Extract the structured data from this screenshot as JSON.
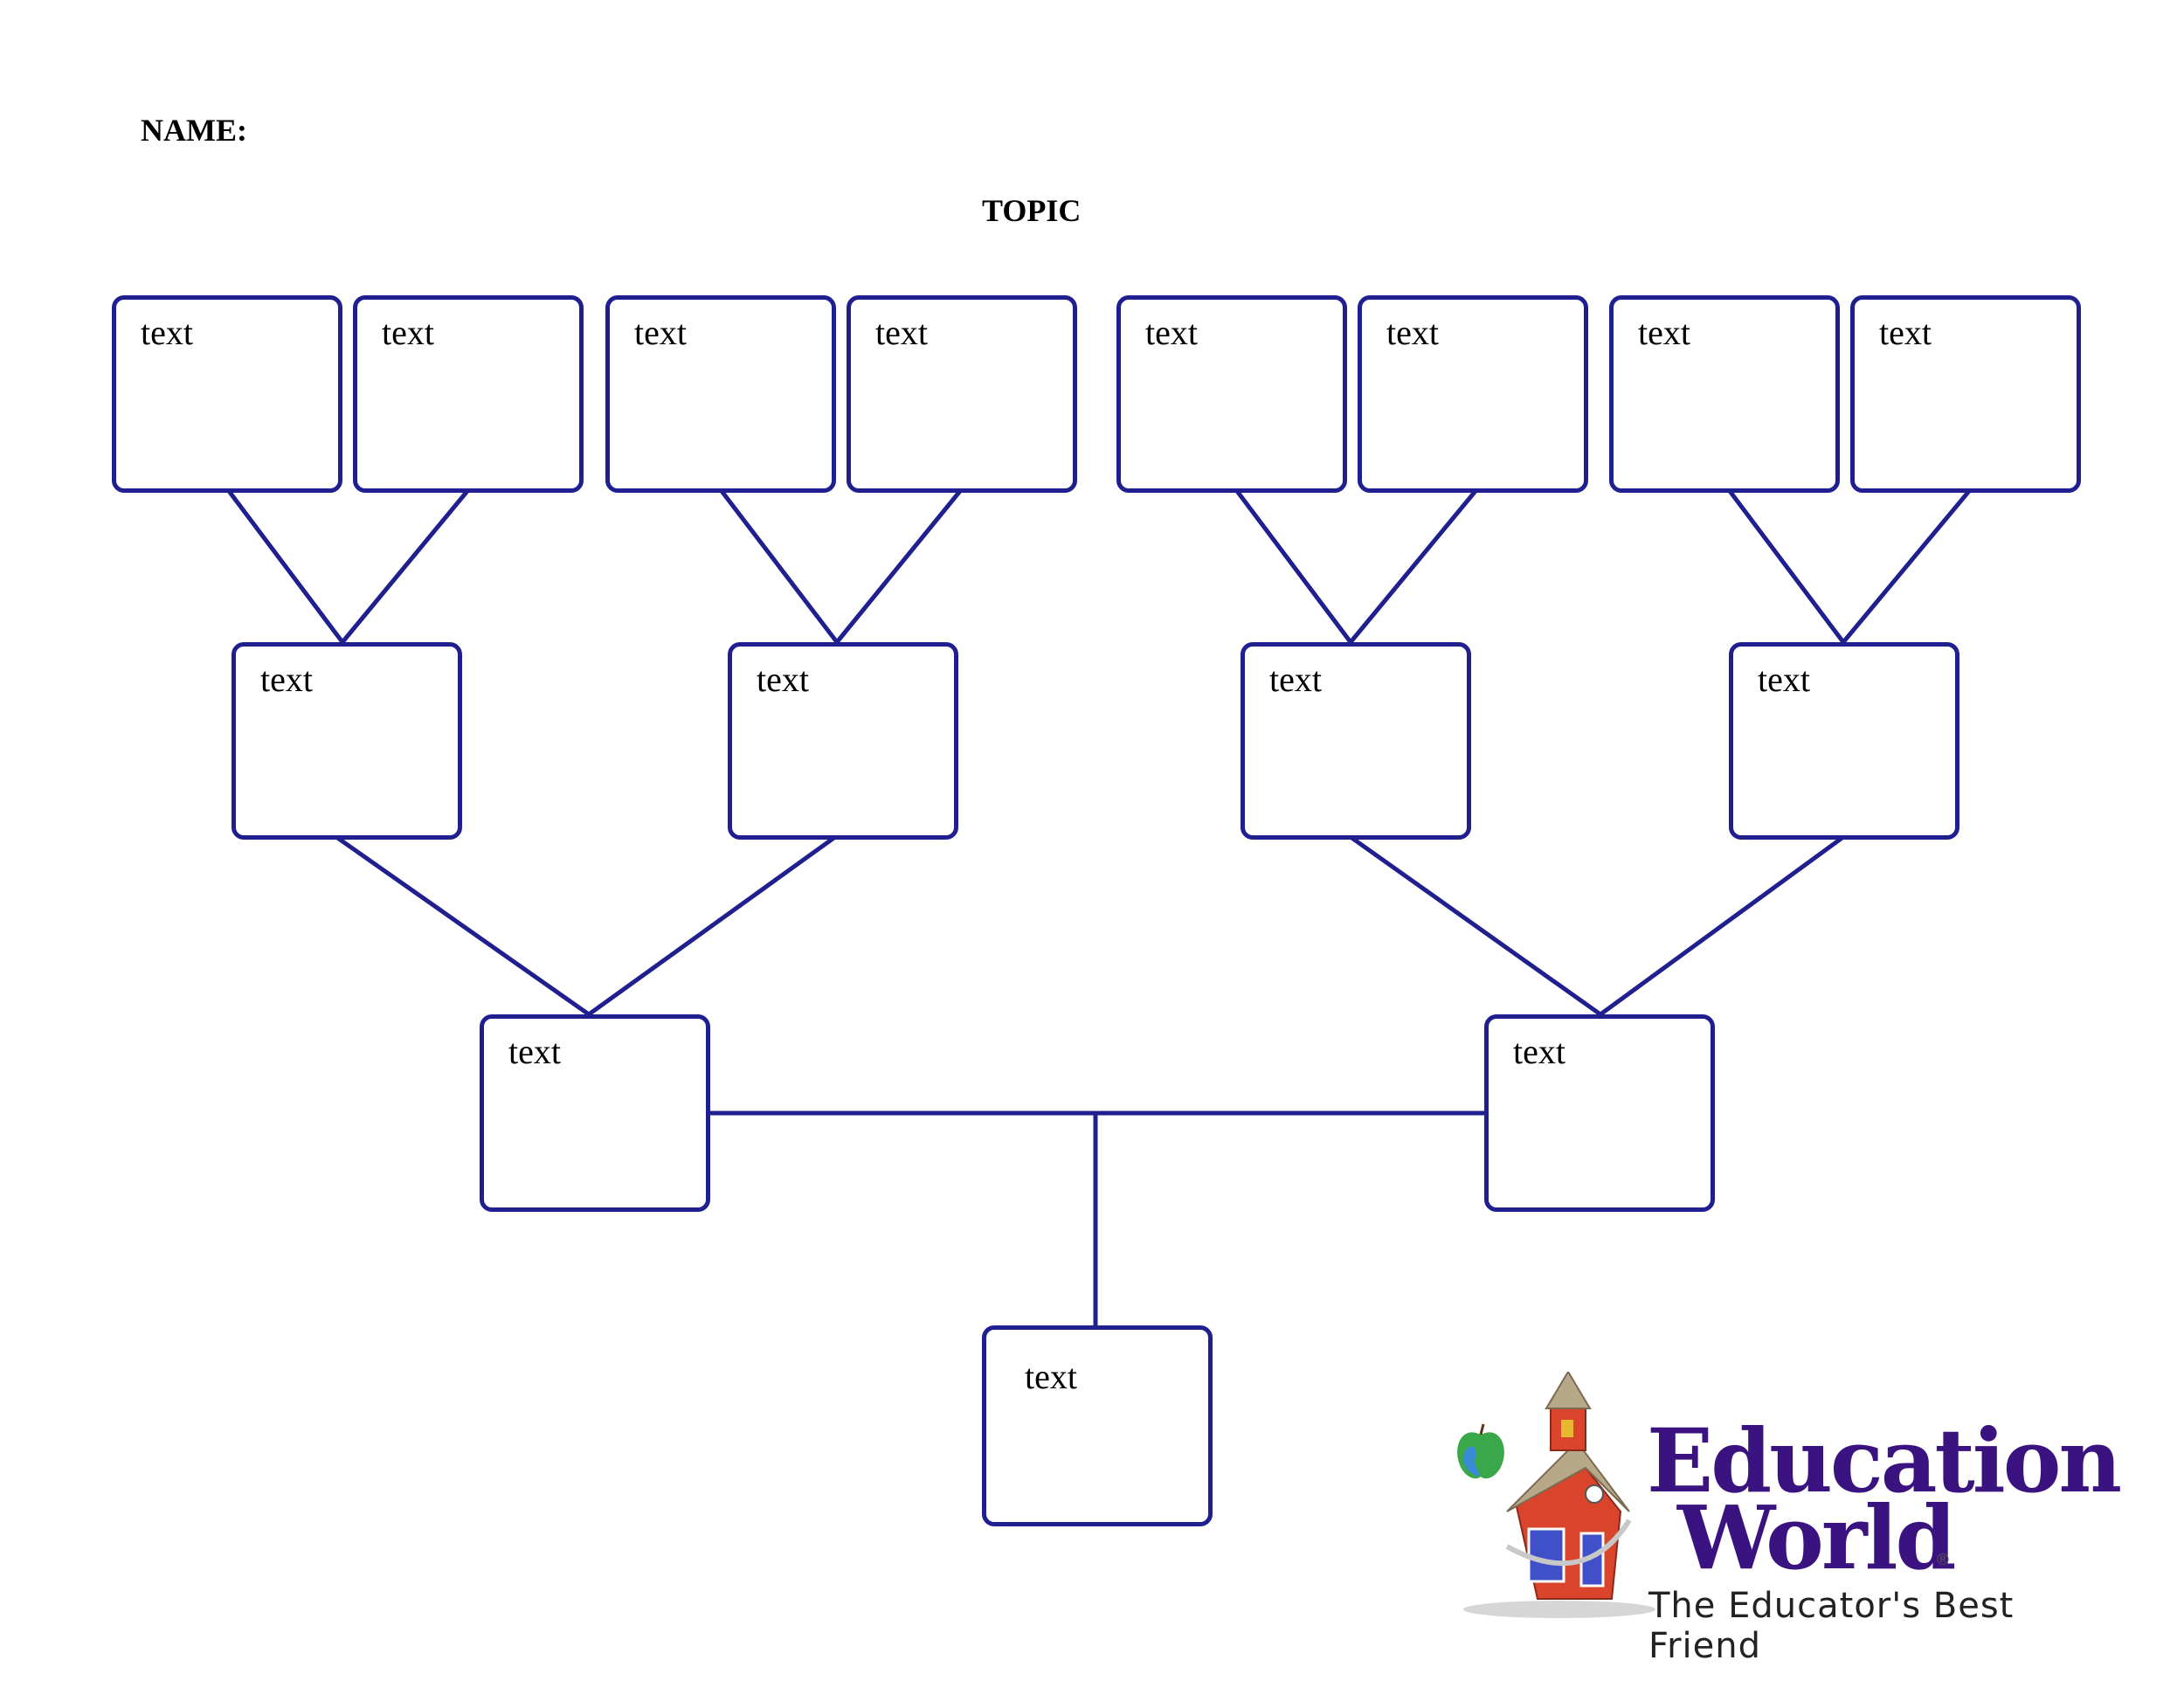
{
  "header": {
    "name_label": "NAME:",
    "topic_title": "TOPIC"
  },
  "diagram": {
    "type": "tree-graphic-organizer",
    "stroke_color": "#1f1f8f",
    "levels": [
      {
        "level": 1,
        "nodes": [
          {
            "id": "t1",
            "label": "text"
          },
          {
            "id": "t2",
            "label": "text"
          },
          {
            "id": "t3",
            "label": "text"
          },
          {
            "id": "t4",
            "label": "text"
          },
          {
            "id": "t5",
            "label": "text"
          },
          {
            "id": "t6",
            "label": "text"
          },
          {
            "id": "t7",
            "label": "text"
          },
          {
            "id": "t8",
            "label": "text"
          }
        ]
      },
      {
        "level": 2,
        "nodes": [
          {
            "id": "m1",
            "label": "text",
            "children": [
              "t1",
              "t2"
            ]
          },
          {
            "id": "m2",
            "label": "text",
            "children": [
              "t3",
              "t4"
            ]
          },
          {
            "id": "m3",
            "label": "text",
            "children": [
              "t5",
              "t6"
            ]
          },
          {
            "id": "m4",
            "label": "text",
            "children": [
              "t7",
              "t8"
            ]
          }
        ]
      },
      {
        "level": 3,
        "nodes": [
          {
            "id": "b1",
            "label": "text",
            "children": [
              "m1",
              "m2"
            ]
          },
          {
            "id": "b2",
            "label": "text",
            "children": [
              "m3",
              "m4"
            ]
          }
        ]
      },
      {
        "level": 4,
        "nodes": [
          {
            "id": "root",
            "label": "text",
            "children": [
              "b1",
              "b2"
            ]
          }
        ]
      }
    ]
  },
  "logo": {
    "brand_line1": "Education",
    "brand_line2": "World",
    "registered": "®",
    "tagline": "The Educator's Best Friend",
    "brand_color": "#3b1380"
  }
}
